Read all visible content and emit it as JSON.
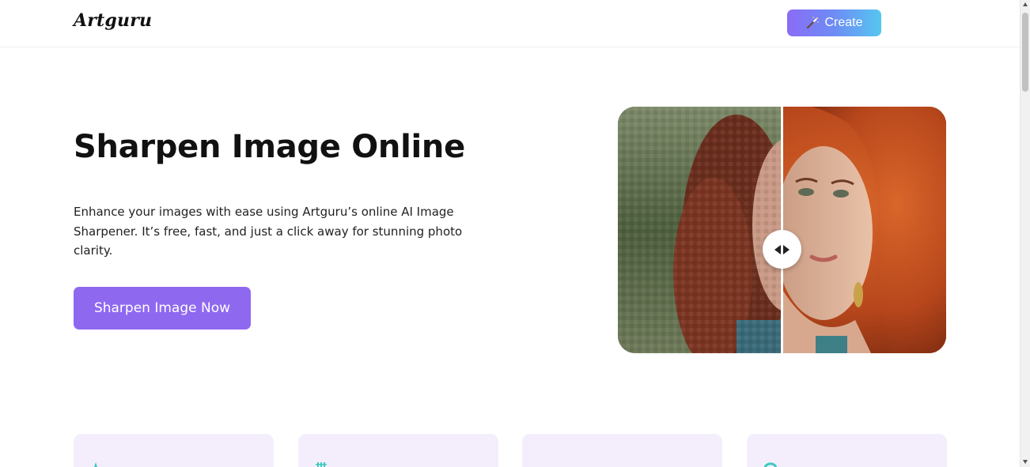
{
  "header": {
    "logo": "Artguru",
    "create_label": "Create"
  },
  "hero": {
    "title": "Sharpen Image Online",
    "description": "Enhance your images with ease using Artguru’s online AI Image Sharpener. It’s free, fast, and just a click away for stunning photo clarity.",
    "cta_label": "Sharpen Image Now"
  },
  "compare": {
    "divider_position": 0.5,
    "left_side": "pixelated",
    "right_side": "sharpened"
  },
  "cards": [
    {
      "icon": "sparkle-icon",
      "icon_color": "#3bc9c0"
    },
    {
      "icon": "grid-icon",
      "icon_color": "#3bc9c0"
    },
    {
      "icon": "blank",
      "icon_color": "#f4eefc"
    },
    {
      "icon": "circle-icon",
      "icon_color": "#3bc9c0"
    }
  ],
  "colors": {
    "accent_purple": "#8f68f0",
    "create_gradient_start": "#8a6cf6",
    "create_gradient_end": "#56c6f0",
    "card_bg": "#f4eefc"
  }
}
